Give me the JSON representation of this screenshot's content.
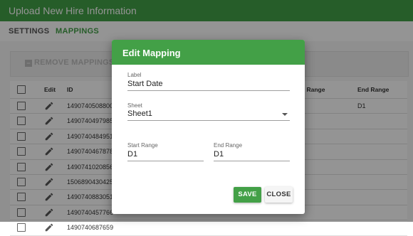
{
  "window": {
    "title": "Upload New Hire Information"
  },
  "tabs": [
    {
      "label": "SETTINGS"
    },
    {
      "label": "MAPPINGS",
      "active": true
    }
  ],
  "toolbar": {
    "remove_label": "REMOVE MAPPINGS"
  },
  "table": {
    "headers": {
      "edit": "Edit",
      "id": "ID",
      "start_range": "rt Range",
      "end_range": "End Range"
    },
    "rows": [
      {
        "id": "1490740508800",
        "end_range": "D1"
      },
      {
        "id": "1490740497985",
        "end_range": ""
      },
      {
        "id": "1490740484951",
        "end_range": ""
      },
      {
        "id": "1490740467878",
        "end_range": ""
      },
      {
        "id": "1490741020856",
        "end_range": ""
      },
      {
        "id": "1506890430425",
        "end_range": ""
      },
      {
        "id": "1490740883051",
        "end_range": ""
      },
      {
        "id": "1490740457766",
        "end_range": ""
      },
      {
        "id": "1490740687659",
        "end_range": ""
      }
    ]
  },
  "dialog": {
    "title": "Edit Mapping",
    "label_field": {
      "label": "Label",
      "value": "Start Date"
    },
    "sheet_field": {
      "label": "Sheet",
      "value": "Sheet1"
    },
    "start_range": {
      "label": "Start Range",
      "value": "D1"
    },
    "end_range": {
      "label": "End Range",
      "value": "D1"
    },
    "save_label": "SAVE",
    "close_label": "CLOSE"
  },
  "colors": {
    "primary": "#43a047",
    "overlay": "rgba(0,0,0,0.42)"
  }
}
